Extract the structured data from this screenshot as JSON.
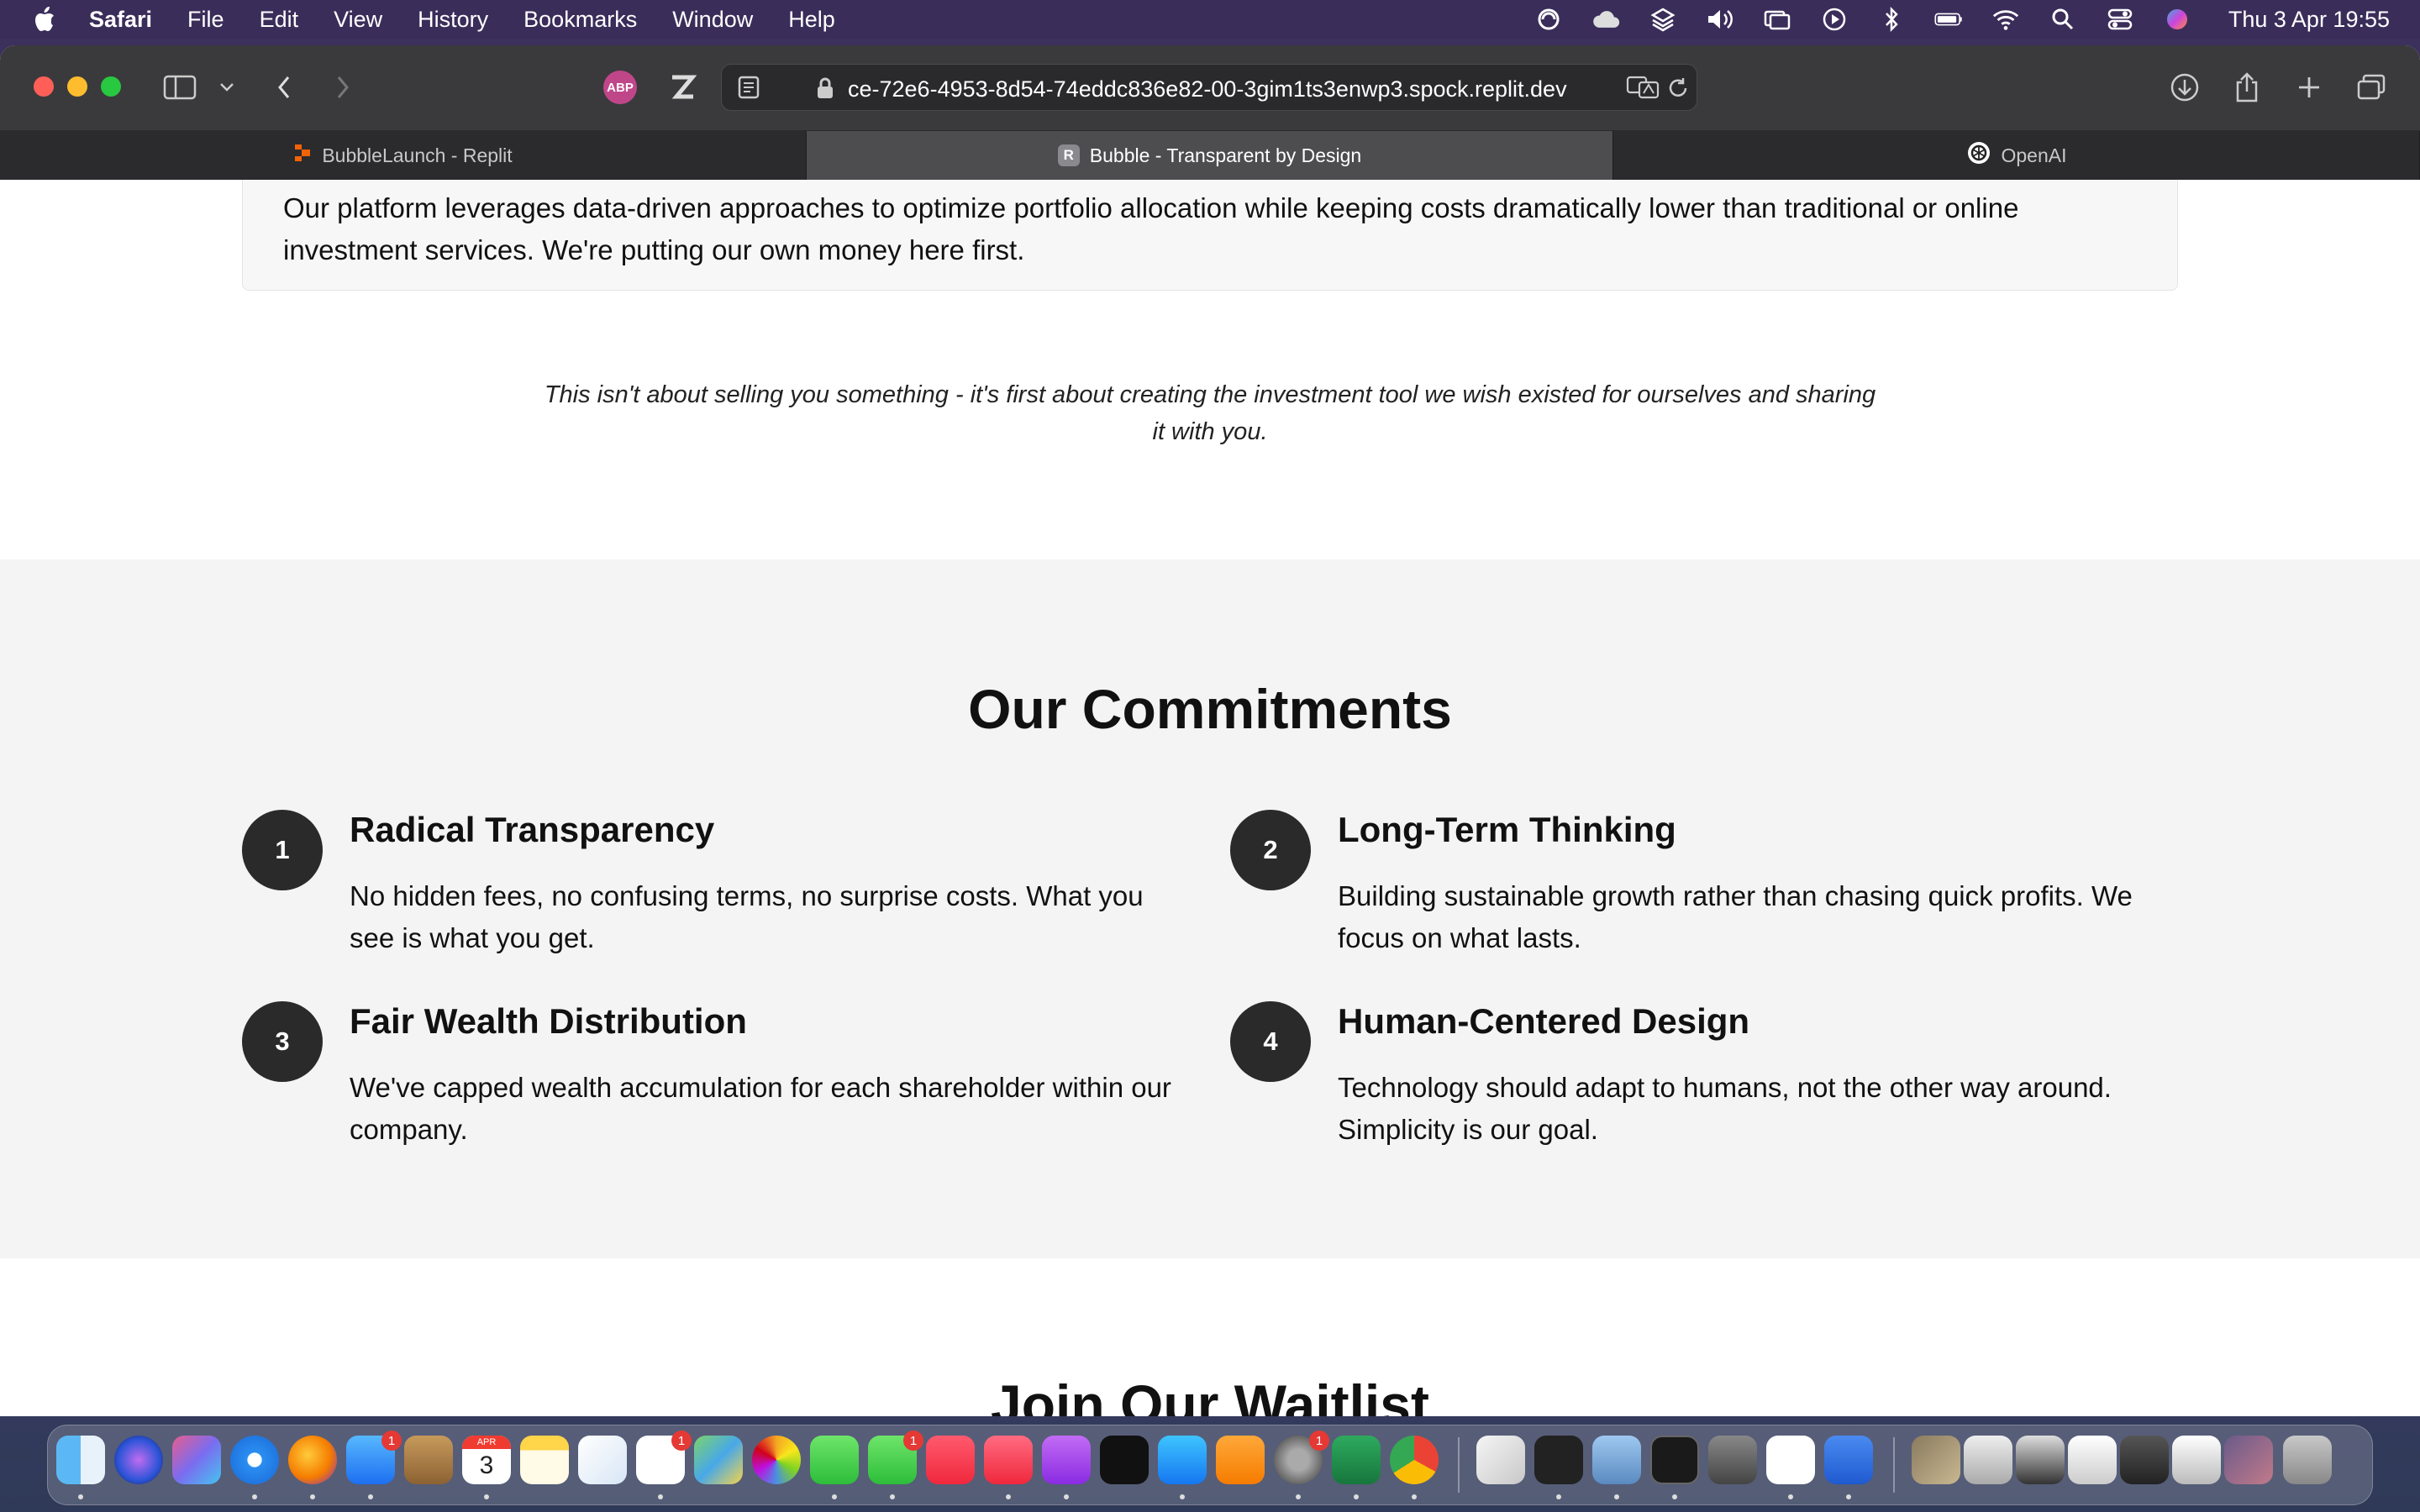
{
  "menubar": {
    "app_name": "Safari",
    "items": [
      "File",
      "Edit",
      "View",
      "History",
      "Bookmarks",
      "Window",
      "Help"
    ],
    "clock": "Thu 3 Apr  19:55"
  },
  "browser": {
    "url": "ce-72e6-4953-8d54-74eddc836e82-00-3gim1ts3enwp3.spock.replit.dev",
    "tabs": [
      {
        "label": "BubbleLaunch - Replit",
        "active": false
      },
      {
        "label": "Bubble - Transparent by Design",
        "active": true
      },
      {
        "label": "OpenAI",
        "active": false
      }
    ],
    "active_tab_favicon": "R",
    "extension_badge": "ABP"
  },
  "page": {
    "card_text": "Our platform leverages data-driven approaches to optimize portfolio allocation while keeping costs dramatically lower than traditional or online investment services. We're putting our own money here first.",
    "quote": "This isn't about selling you something - it's first about creating the investment tool we wish existed for ourselves and sharing it with you.",
    "commitments": {
      "title": "Our Commitments",
      "items": [
        {
          "num": "1",
          "title": "Radical Transparency",
          "text": "No hidden fees, no confusing terms, no surprise costs. What you see is what you get."
        },
        {
          "num": "2",
          "title": "Long-Term Thinking",
          "text": "Building sustainable growth rather than chasing quick profits. We focus on what lasts."
        },
        {
          "num": "3",
          "title": "Fair Wealth Distribution",
          "text": "We've capped wealth accumulation for each shareholder within our company."
        },
        {
          "num": "4",
          "title": "Human-Centered Design",
          "text": "Technology should adapt to humans, not the other way around. Simplicity is our goal."
        }
      ]
    },
    "waitlist_title": "Join Our Waitlist"
  },
  "dock": {
    "calendar_month": "APR",
    "calendar_day": "3",
    "badges": {
      "mail": "1",
      "reminders": "1",
      "facetime": "1",
      "settings": "1"
    }
  }
}
